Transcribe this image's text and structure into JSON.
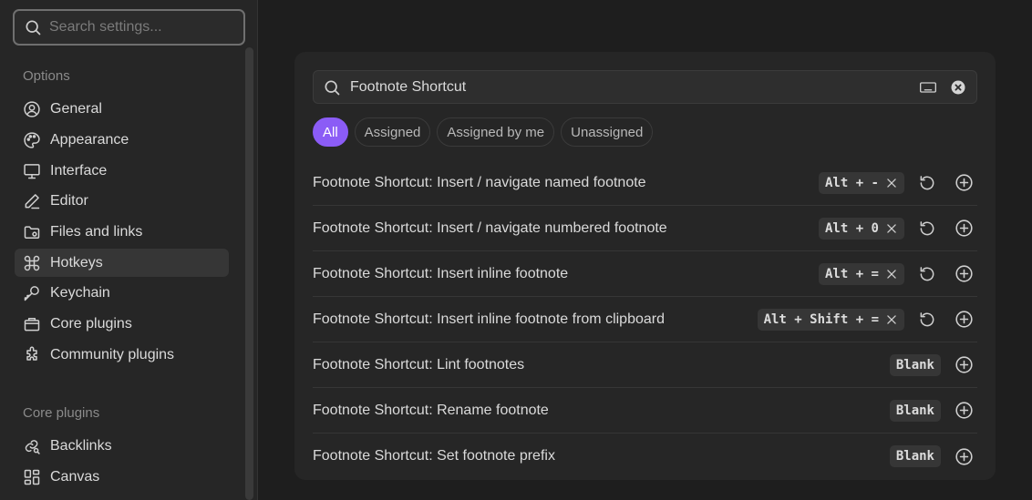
{
  "sidebar": {
    "search_placeholder": "Search settings...",
    "section_options": "Options",
    "items": [
      {
        "label": "General",
        "icon": "user-circle-icon",
        "active": false
      },
      {
        "label": "Appearance",
        "icon": "palette-icon",
        "active": false
      },
      {
        "label": "Interface",
        "icon": "monitor-icon",
        "active": false
      },
      {
        "label": "Editor",
        "icon": "pen-icon",
        "active": false
      },
      {
        "label": "Files and links",
        "icon": "folder-icon",
        "active": false
      },
      {
        "label": "Hotkeys",
        "icon": "command-icon",
        "active": true
      },
      {
        "label": "Keychain",
        "icon": "key-icon",
        "active": false
      },
      {
        "label": "Core plugins",
        "icon": "briefcase-icon",
        "active": false
      },
      {
        "label": "Community plugins",
        "icon": "puzzle-icon",
        "active": false
      }
    ],
    "section_core": "Core plugins",
    "core_items": [
      {
        "label": "Backlinks",
        "icon": "link-search-icon"
      },
      {
        "label": "Canvas",
        "icon": "layout-dashboard-icon"
      }
    ]
  },
  "hotkeys": {
    "search_value": "Footnote Shortcut",
    "filters": [
      "All",
      "Assigned",
      "Assigned by me",
      "Unassigned"
    ],
    "active_filter": "All",
    "rows": [
      {
        "name": "Footnote Shortcut: Insert / navigate named footnote",
        "hotkey": "Alt + -",
        "assigned": true
      },
      {
        "name": "Footnote Shortcut: Insert / navigate numbered footnote",
        "hotkey": "Alt + 0",
        "assigned": true
      },
      {
        "name": "Footnote Shortcut: Insert inline footnote",
        "hotkey": "Alt + =",
        "assigned": true
      },
      {
        "name": "Footnote Shortcut: Insert inline footnote from clipboard",
        "hotkey": "Alt + Shift + =",
        "assigned": true
      },
      {
        "name": "Footnote Shortcut: Lint footnotes",
        "hotkey": "Blank",
        "assigned": false
      },
      {
        "name": "Footnote Shortcut: Rename footnote",
        "hotkey": "Blank",
        "assigned": false
      },
      {
        "name": "Footnote Shortcut: Set footnote prefix",
        "hotkey": "Blank",
        "assigned": false
      }
    ]
  },
  "colors": {
    "accent": "#8b5cf6",
    "background": "#1e1e1e",
    "sidebar": "#262626",
    "text": "#dadada",
    "muted": "#8a8a8a"
  }
}
